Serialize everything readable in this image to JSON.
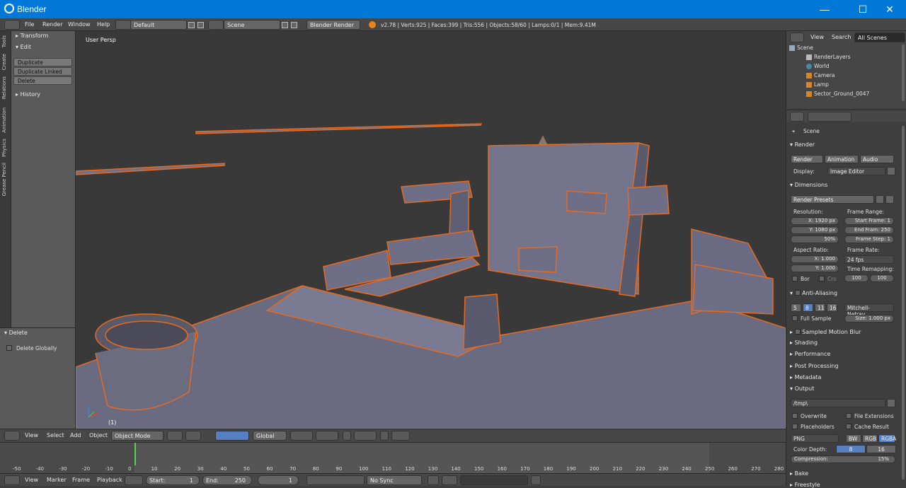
{
  "window": {
    "title": "Blender",
    "minimize": "—",
    "maximize": "☐",
    "close": "✕"
  },
  "topbar": {
    "menus": [
      "File",
      "Render",
      "Window",
      "Help"
    ],
    "layout": "Default",
    "scene": "Scene",
    "engine": "Blender Render",
    "stats": "v2.78 | Verts:925 | Faces:399 | Tris:556 | Objects:58/60 | Lamps:0/1 | Mem:9.41M"
  },
  "tabs": [
    "Tools",
    "Create",
    "Relations",
    "Animation",
    "Physics",
    "Grease Pencil"
  ],
  "toolshelf": {
    "transform": "Transform",
    "edit": "Edit",
    "buttons": [
      "Duplicate",
      "Duplicate Linked",
      "Delete"
    ],
    "history": "History"
  },
  "operator": {
    "title": "Delete",
    "option": "Delete Globally"
  },
  "viewport": {
    "label": "User Persp",
    "frame": "(1)"
  },
  "viewport_header": {
    "menus": [
      "View",
      "Select",
      "Add",
      "Object"
    ],
    "mode": "Object Mode",
    "orientation": "Global"
  },
  "timeline": {
    "ticks": [
      "-50",
      "-40",
      "-30",
      "-20",
      "-10",
      "0",
      "10",
      "20",
      "30",
      "40",
      "50",
      "60",
      "70",
      "80",
      "90",
      "100",
      "110",
      "120",
      "130",
      "140",
      "150",
      "160",
      "170",
      "180",
      "190",
      "200",
      "210",
      "220",
      "230",
      "240",
      "250",
      "260",
      "270",
      "280"
    ],
    "current_frame": 1
  },
  "timeline_header": {
    "menus": [
      "View",
      "Marker",
      "Frame",
      "Playback"
    ],
    "start": "Start:",
    "start_val": "1",
    "end": "End:",
    "end_val": "250",
    "frame_val": "1",
    "sync": "No Sync"
  },
  "outliner": {
    "header": [
      "View",
      "Search",
      "All Scenes"
    ],
    "rows": [
      "Scene",
      "RenderLayers",
      "World",
      "Camera",
      "Lamp",
      "Sector_Ground_0047"
    ]
  },
  "properties": {
    "scene": "Scene",
    "render": {
      "title": "Render",
      "buttons": [
        "Render",
        "Animation",
        "Audio"
      ],
      "display_label": "Display:",
      "display": "Image Editor"
    },
    "dimensions": {
      "title": "Dimensions",
      "presets": "Render Presets",
      "resolution": "Resolution:",
      "res_x": "1920 px",
      "res_y": "1080 px",
      "res_pct": "50%",
      "frame_range": "Frame Range:",
      "start_frame": "Start Frame: 1",
      "end_frame": "End Fram: 250",
      "frame_step": "Frame Step: 1",
      "aspect": "Aspect Ratio:",
      "asp_x": "1.000",
      "asp_y": "1.000",
      "frame_rate": "Frame Rate:",
      "fps": "24 fps",
      "remap": "Time Remapping:",
      "remap_old": "100",
      "remap_new": "100",
      "border": "Bor",
      "crop": "Cro"
    },
    "aa": {
      "title": "Anti-Aliasing",
      "samples": [
        "5",
        "8",
        "11",
        "16"
      ],
      "filter": "Mitchell-Netrav...",
      "full_sample": "Full Sample",
      "size": "Size: 1.000 px"
    },
    "collapsed": [
      "Sampled Motion Blur",
      "Shading",
      "Performance",
      "Post Processing",
      "Metadata"
    ],
    "output": {
      "title": "Output",
      "path": "/tmp\\",
      "overwrite": "Overwrite",
      "file_ext": "File Extensions",
      "placeholders": "Placeholders",
      "cache": "Cache Result",
      "format": "PNG",
      "bw": "BW",
      "rgb": "RGB",
      "rgba": "RGBA",
      "depth_label": "Color Depth:",
      "depth8": "8",
      "depth16": "16",
      "compression": "Compression:",
      "compression_val": "15%"
    },
    "bake": "Bake",
    "freestyle": "Freestyle"
  },
  "colors": {
    "accent": "#5680c2",
    "selection": "#e86a1e",
    "titlebar": "#0078d7"
  }
}
